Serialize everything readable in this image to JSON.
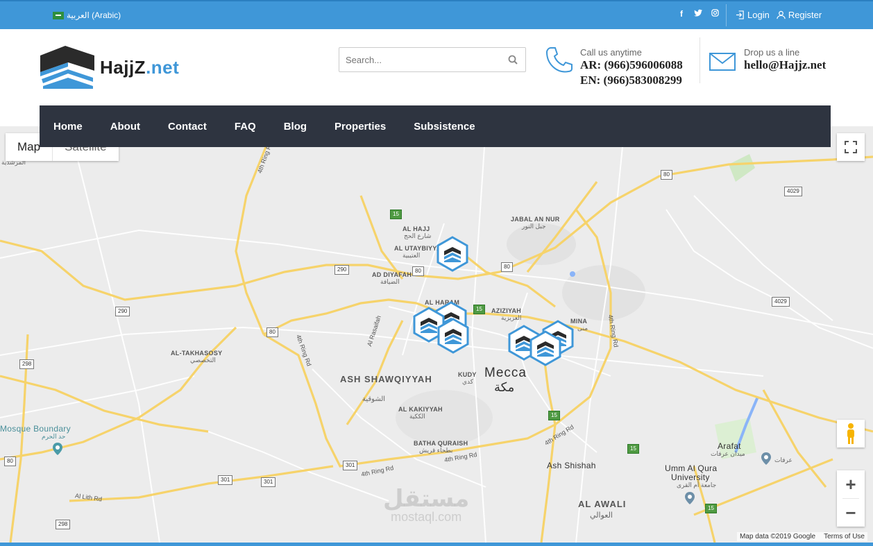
{
  "topbar": {
    "language": "العربية (Arabic)",
    "social": [
      "f",
      "t",
      "ig"
    ],
    "login": "Login",
    "register": "Register"
  },
  "header": {
    "logo_main": "HajjZ",
    "logo_tld": ".net",
    "search_placeholder": "Search...",
    "call_label": "Call us anytime",
    "phone_ar": "AR: (966)596006088",
    "phone_en": "EN: (966)583008299",
    "mail_label": "Drop us a line",
    "email": "hello@Hajjz.net"
  },
  "nav": {
    "items": [
      "Home",
      "About",
      "Contact",
      "FAQ",
      "Blog",
      "Properties",
      "Subsistence"
    ]
  },
  "map": {
    "type_map": "Map",
    "type_satellite": "Satellite",
    "zoom_in": "+",
    "zoom_out": "−",
    "attribution": "Map data ©2019 Google",
    "terms": "Terms of Use",
    "labels": {
      "mecca": "Mecca",
      "mecca_ar": "مكة",
      "shawqiyyah": "ASH SHAWQIYYAH",
      "shawqiyyah_ar": "الشوقية",
      "jabal": "JABAL AN NUR",
      "jabal_ar": "جبل النور",
      "alhajj": "AL HAJJ",
      "alhajj_ar": "شارع الحج",
      "utaybiyya": "AL UTAYBIYYA",
      "utaybiyya_ar": "العتيبية",
      "diyafah": "AD DIYAFAH",
      "diyafah_ar": "الضيافة",
      "azizyah": "AZIZIYAH",
      "azizyah_ar": "العزيزية",
      "haram": "AL HARAM",
      "mina": "MINA",
      "mina_ar": "منى",
      "takhasosy": "AL-TAKHASOSY",
      "takhasosy_ar": "التخصصي",
      "kudy": "KUDY",
      "kudy_ar": "كدي",
      "kakiyyah": "AL KAKIYYAH",
      "kakiyyah_ar": "الككية",
      "batha": "BATHA QURAISH",
      "batha_ar": "بطحاء قريش",
      "shishah": "Ash Shishah",
      "awali": "AL AWALI",
      "awali_ar": "العوالي",
      "arafat": "Arafat",
      "arafat_ar": "ميدان عرفات",
      "arafat_ar2": "عرفات",
      "umm": "Umm Al Qura",
      "univ": "University",
      "umm_ar": "جامعة أم القرى",
      "mosque": "Mosque Boundary",
      "mosque_ar": "حد الحرم",
      "murshadiya": "المرشدية",
      "rasaifah": "Al Rasaifah",
      "ring4": "4th Ring Rd",
      "allith": "Al Lith Rd"
    },
    "shields": [
      "15",
      "290",
      "80",
      "80",
      "290",
      "80",
      "298",
      "301",
      "301",
      "301",
      "298",
      "15",
      "15",
      "15",
      "15",
      "80",
      "4029",
      "4029",
      "80"
    ]
  },
  "watermark": {
    "arabic": "مستقل",
    "latin": "mostaql.com"
  },
  "colors": {
    "brand_blue": "#3f97d8",
    "nav_dark": "#2e3440",
    "road_yellow": "#f6d36b",
    "park_green": "#cfe8c4",
    "water": "#8ab4f8"
  }
}
